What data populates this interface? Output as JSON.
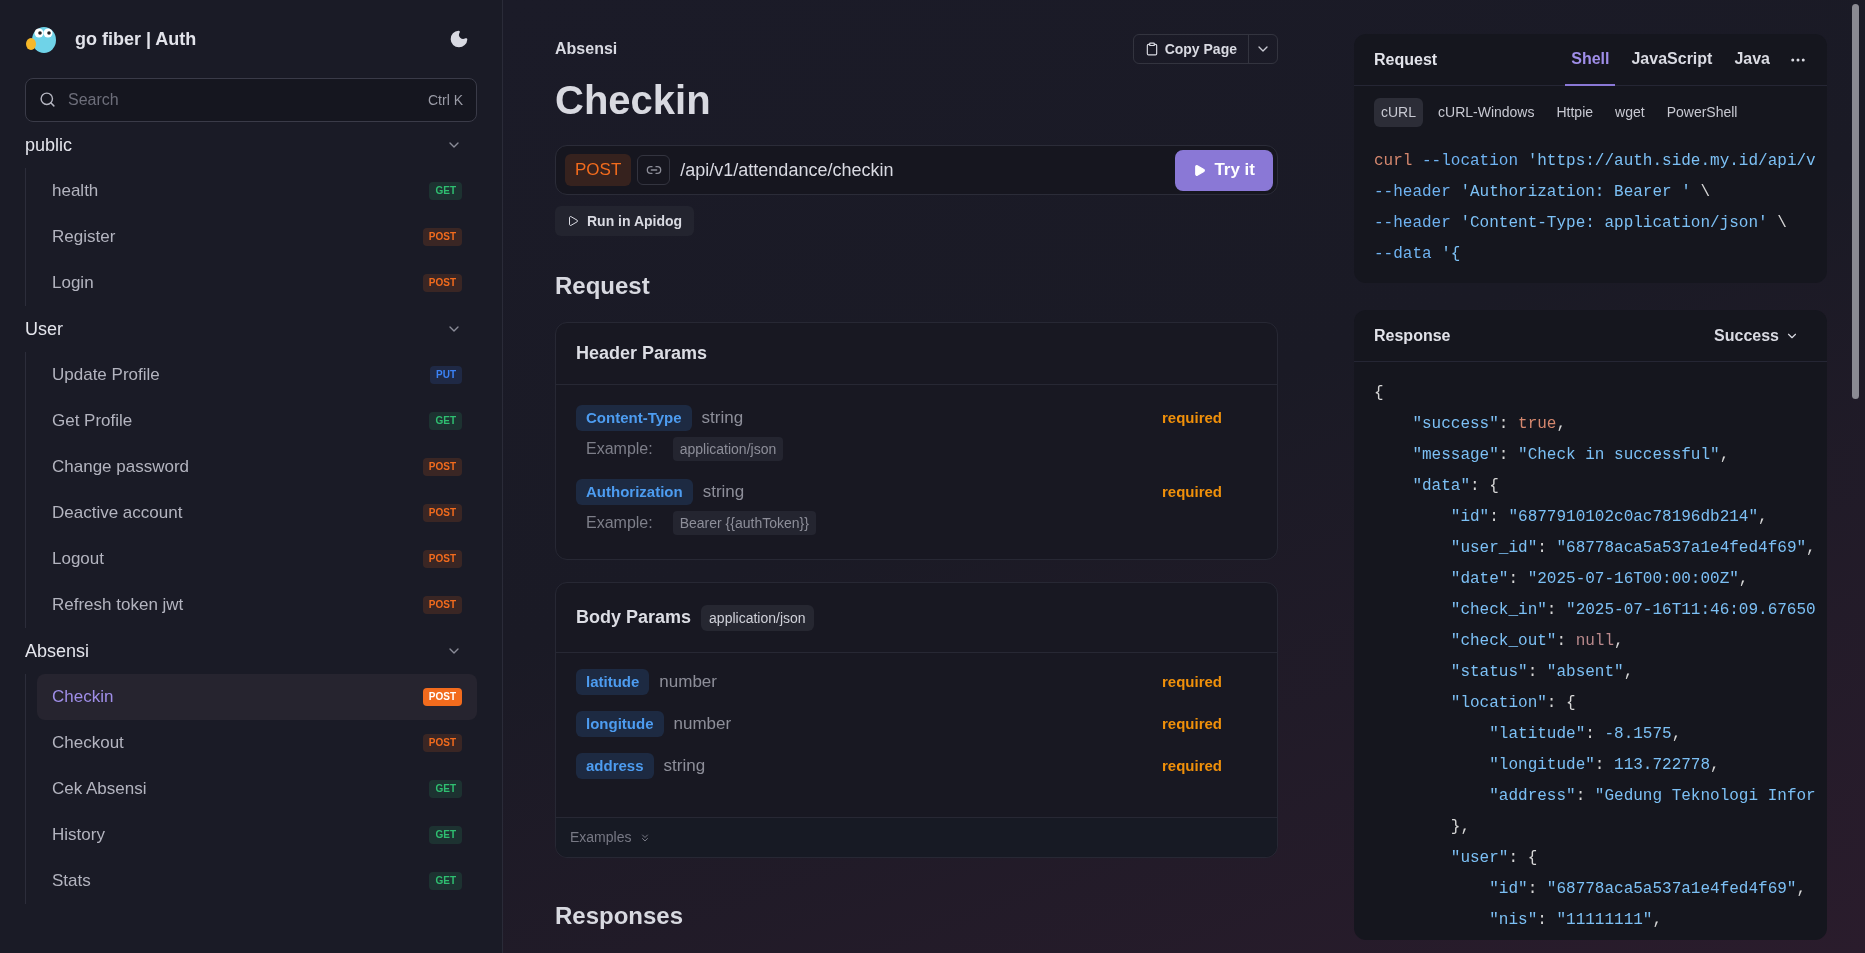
{
  "sidebar": {
    "title": "go fiber | Auth",
    "search": {
      "placeholder": "Search",
      "shortcut": "Ctrl K"
    },
    "groups": [
      {
        "label": "public",
        "expanded": true,
        "items": [
          {
            "label": "health",
            "method": "GET",
            "kind": "get",
            "selected": false
          },
          {
            "label": "Register",
            "method": "POST",
            "kind": "post",
            "selected": false
          },
          {
            "label": "Login",
            "method": "POST",
            "kind": "post",
            "selected": false
          }
        ]
      },
      {
        "label": "User",
        "expanded": true,
        "items": [
          {
            "label": "Update Profile",
            "method": "PUT",
            "kind": "put",
            "selected": false
          },
          {
            "label": "Get Profile",
            "method": "GET",
            "kind": "get",
            "selected": false
          },
          {
            "label": "Change password",
            "method": "POST",
            "kind": "post",
            "selected": false
          },
          {
            "label": "Deactive account",
            "method": "POST",
            "kind": "post",
            "selected": false
          },
          {
            "label": "Logout",
            "method": "POST",
            "kind": "post",
            "selected": false
          },
          {
            "label": "Refresh token jwt",
            "method": "POST",
            "kind": "post",
            "selected": false
          }
        ]
      },
      {
        "label": "Absensi",
        "expanded": true,
        "items": [
          {
            "label": "Checkin",
            "method": "POST",
            "kind": "post",
            "selected": true
          },
          {
            "label": "Checkout",
            "method": "POST",
            "kind": "post",
            "selected": false
          },
          {
            "label": "Cek Absensi",
            "method": "GET",
            "kind": "get",
            "selected": false
          },
          {
            "label": "History",
            "method": "GET",
            "kind": "get",
            "selected": false
          },
          {
            "label": "Stats",
            "method": "GET",
            "kind": "get",
            "selected": false
          }
        ]
      }
    ]
  },
  "main": {
    "breadcrumb": "Absensi",
    "copy_button": "Copy Page",
    "title": "Checkin",
    "endpoint": {
      "method": "POST",
      "kind": "post",
      "path": "/api/v1/attendance/checkin"
    },
    "try_button": "Try it",
    "run_button": "Run in Apidog",
    "request_heading": "Request",
    "header_params": {
      "title": "Header Params",
      "params": [
        {
          "name": "Content-Type",
          "type": "string",
          "required_label": "required",
          "example_label": "Example:",
          "example": "application/json"
        },
        {
          "name": "Authorization",
          "type": "string",
          "required_label": "required",
          "example_label": "Example:",
          "example": "Bearer {{authToken}}"
        }
      ]
    },
    "body_params": {
      "title": "Body Params",
      "content_type": "application/json",
      "params": [
        {
          "name": "latitude",
          "type": "number",
          "required_label": "required"
        },
        {
          "name": "longitude",
          "type": "number",
          "required_label": "required"
        },
        {
          "name": "address",
          "type": "string",
          "required_label": "required"
        }
      ],
      "examples_label": "Examples"
    },
    "responses_heading": "Responses"
  },
  "request_panel": {
    "title": "Request",
    "tabs": [
      {
        "label": "Shell",
        "selected": true
      },
      {
        "label": "JavaScript",
        "selected": false
      },
      {
        "label": "Java",
        "selected": false
      }
    ],
    "sub_tabs": [
      {
        "label": "cURL",
        "selected": true
      },
      {
        "label": "cURL-Windows",
        "selected": false
      },
      {
        "label": "Httpie",
        "selected": false
      },
      {
        "label": "wget",
        "selected": false
      },
      {
        "label": "PowerShell",
        "selected": false
      }
    ],
    "code": [
      [
        {
          "kind": "command",
          "text": "curl"
        },
        {
          "kind": "option",
          "text": " --location"
        },
        {
          "kind": "string",
          "text": " 'https://auth.side.my.id/api/v"
        }
      ],
      [
        {
          "kind": "option",
          "text": "--header"
        },
        {
          "kind": "string",
          "text": " 'Authorization: Bearer '"
        },
        {
          "kind": "punct",
          "text": " \\"
        }
      ],
      [
        {
          "kind": "option",
          "text": "--header"
        },
        {
          "kind": "string",
          "text": " 'Content-Type: application/json'"
        },
        {
          "kind": "punct",
          "text": " \\"
        }
      ],
      [
        {
          "kind": "option",
          "text": "--data"
        },
        {
          "kind": "string",
          "text": " '{"
        }
      ]
    ]
  },
  "response_panel": {
    "title": "Response",
    "status": "Success",
    "code": [
      [
        {
          "kind": "punct",
          "text": "{"
        }
      ],
      [
        {
          "kind": "key",
          "text": "    \"success\""
        },
        {
          "kind": "punct",
          "text": ": "
        },
        {
          "kind": "literal",
          "text": "true"
        },
        {
          "kind": "punct",
          "text": ","
        }
      ],
      [
        {
          "kind": "key",
          "text": "    \"message\""
        },
        {
          "kind": "punct",
          "text": ": "
        },
        {
          "kind": "string",
          "text": "\"Check in successful\""
        },
        {
          "kind": "punct",
          "text": ","
        }
      ],
      [
        {
          "kind": "key",
          "text": "    \"data\""
        },
        {
          "kind": "punct",
          "text": ": {"
        }
      ],
      [
        {
          "kind": "key",
          "text": "        \"id\""
        },
        {
          "kind": "punct",
          "text": ": "
        },
        {
          "kind": "string",
          "text": "\"6877910102c0ac78196db214\""
        },
        {
          "kind": "punct",
          "text": ","
        }
      ],
      [
        {
          "kind": "key",
          "text": "        \"user_id\""
        },
        {
          "kind": "punct",
          "text": ": "
        },
        {
          "kind": "string",
          "text": "\"68778aca5a537a1e4fed4f69\""
        },
        {
          "kind": "punct",
          "text": ","
        }
      ],
      [
        {
          "kind": "key",
          "text": "        \"date\""
        },
        {
          "kind": "punct",
          "text": ": "
        },
        {
          "kind": "string",
          "text": "\"2025-07-16T00:00:00Z\""
        },
        {
          "kind": "punct",
          "text": ","
        }
      ],
      [
        {
          "kind": "key",
          "text": "        \"check_in\""
        },
        {
          "kind": "punct",
          "text": ": "
        },
        {
          "kind": "string",
          "text": "\"2025-07-16T11:46:09.67650"
        }
      ],
      [
        {
          "kind": "key",
          "text": "        \"check_out\""
        },
        {
          "kind": "punct",
          "text": ": "
        },
        {
          "kind": "null",
          "text": "null"
        },
        {
          "kind": "punct",
          "text": ","
        }
      ],
      [
        {
          "kind": "key",
          "text": "        \"status\""
        },
        {
          "kind": "punct",
          "text": ": "
        },
        {
          "kind": "string",
          "text": "\"absent\""
        },
        {
          "kind": "punct",
          "text": ","
        }
      ],
      [
        {
          "kind": "key",
          "text": "        \"location\""
        },
        {
          "kind": "punct",
          "text": ": {"
        }
      ],
      [
        {
          "kind": "key",
          "text": "            \"latitude\""
        },
        {
          "kind": "punct",
          "text": ": "
        },
        {
          "kind": "number",
          "text": "-8.1575"
        },
        {
          "kind": "punct",
          "text": ","
        }
      ],
      [
        {
          "kind": "key",
          "text": "            \"longitude\""
        },
        {
          "kind": "punct",
          "text": ": "
        },
        {
          "kind": "number",
          "text": "113.722778"
        },
        {
          "kind": "punct",
          "text": ","
        }
      ],
      [
        {
          "kind": "key",
          "text": "            \"address\""
        },
        {
          "kind": "punct",
          "text": ": "
        },
        {
          "kind": "string",
          "text": "\"Gedung Teknologi Infor"
        }
      ],
      [
        {
          "kind": "punct",
          "text": "        },"
        }
      ],
      [
        {
          "kind": "key",
          "text": "        \"user\""
        },
        {
          "kind": "punct",
          "text": ": {"
        }
      ],
      [
        {
          "kind": "key",
          "text": "            \"id\""
        },
        {
          "kind": "punct",
          "text": ": "
        },
        {
          "kind": "string",
          "text": "\"68778aca5a537a1e4fed4f69\""
        },
        {
          "kind": "punct",
          "text": ","
        }
      ],
      [
        {
          "kind": "key",
          "text": "            \"nis\""
        },
        {
          "kind": "punct",
          "text": ": "
        },
        {
          "kind": "string",
          "text": "\"11111111\""
        },
        {
          "kind": "punct",
          "text": ","
        }
      ]
    ]
  }
}
